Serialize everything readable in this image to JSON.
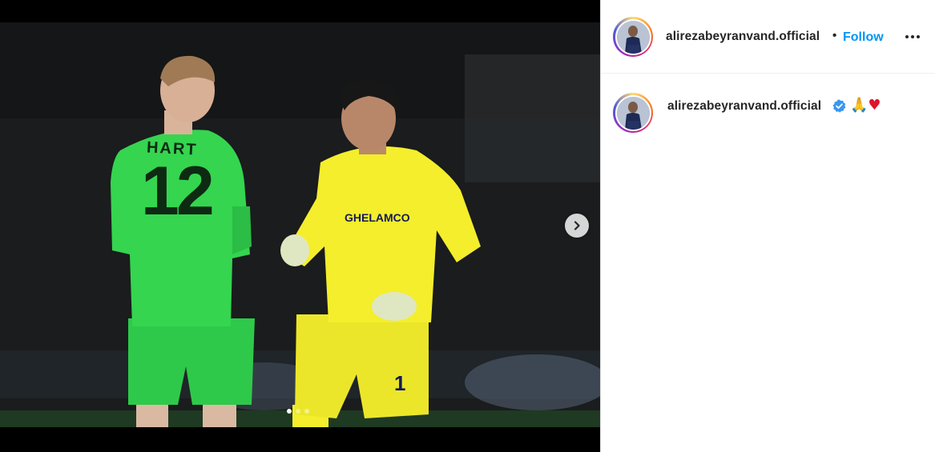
{
  "post": {
    "photo_alt": "",
    "carousel": {
      "total": 3,
      "active_index": 0
    },
    "players": {
      "left": {
        "jersey_name": "HART",
        "jersey_number": "12",
        "color": "#35d54f"
      },
      "right": {
        "sponsor": "GHELAMCO",
        "number": "1",
        "color": "#f4ee2c"
      }
    }
  },
  "header": {
    "username": "alirezabeyranvand.official",
    "separator": "•",
    "follow_label": "Follow"
  },
  "caption": {
    "username": "alirezabeyranvand.official",
    "verified": true,
    "text_emoji_1": "🙏",
    "text_emoji_2": "♥"
  },
  "colors": {
    "accent": "#0095f6",
    "verified": "#3897f0",
    "border": "#dbdbdb"
  },
  "icons": {
    "next": "chevron-right-icon",
    "more": "more-options-icon",
    "verified": "verified-badge-icon"
  }
}
